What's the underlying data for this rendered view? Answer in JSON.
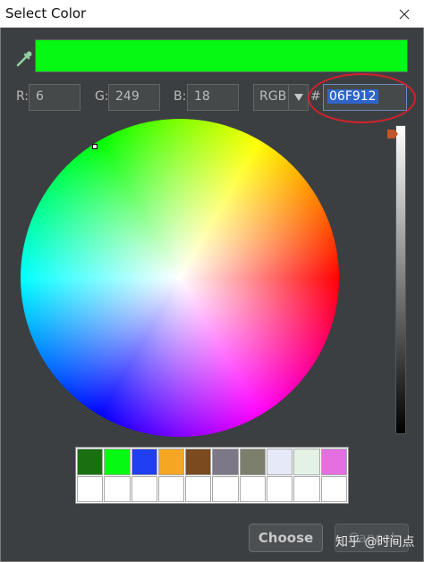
{
  "window": {
    "title": "Select Color",
    "close_icon": "close-icon"
  },
  "preview": {
    "color": "#06F912",
    "eyedropper_icon": "eyedropper-icon"
  },
  "channels": [
    {
      "label": "R:",
      "value": "6"
    },
    {
      "label": "G:",
      "value": "249"
    },
    {
      "label": "B:",
      "value": "18"
    }
  ],
  "mode": {
    "value": "RGB",
    "dropdown_icon": "triangle-down-icon"
  },
  "hex": {
    "prefix": "#",
    "value": "06F912",
    "highlight_color": "#d4212c"
  },
  "wheel": {
    "cursor_icon": "wheel-cursor"
  },
  "brightness": {
    "level": 1.0,
    "thumb_icon": "brightness-thumb-icon",
    "thumb_color": "#c0562a"
  },
  "swatches": {
    "row1": [
      "#1a7010",
      "#06f912",
      "#1f3ff0",
      "#f5a623",
      "#7b4a1f",
      "#7c7887",
      "#7b7f6c",
      "#e6e9f7",
      "#e4f2e6",
      "#e56fe0"
    ],
    "row2": [
      "#ffffff",
      "#ffffff",
      "#ffffff",
      "#ffffff",
      "#ffffff",
      "#ffffff",
      "#ffffff",
      "#ffffff",
      "#ffffff",
      "#ffffff"
    ]
  },
  "buttons": {
    "choose": "Choose",
    "cancel": "Cancel"
  },
  "watermark": "知乎 @时间点"
}
